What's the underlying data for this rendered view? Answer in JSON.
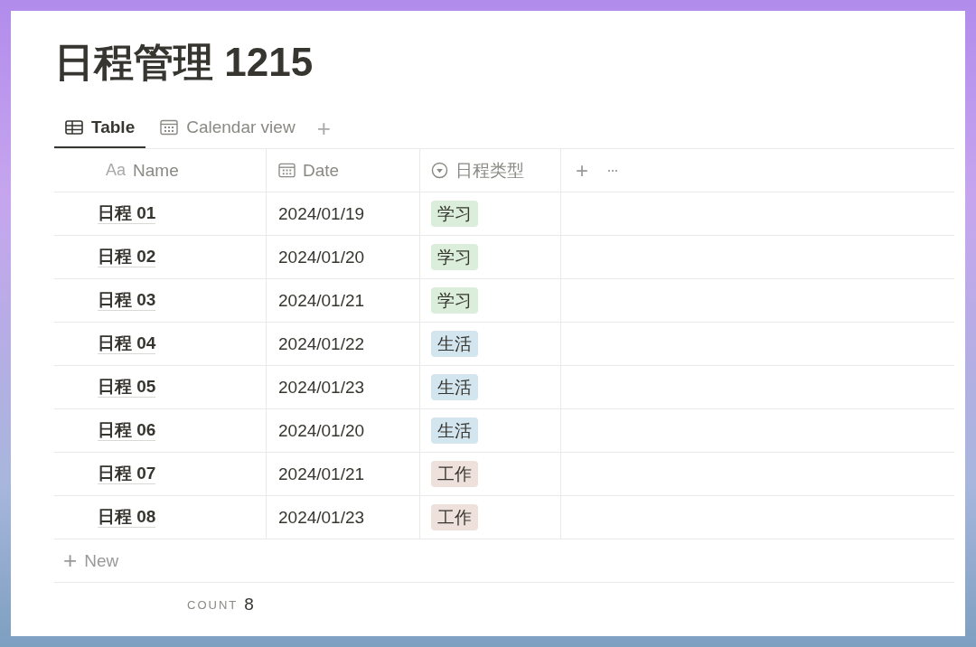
{
  "title": "日程管理 1215",
  "tabs": [
    {
      "label": "Table",
      "kind": "table",
      "selected": true
    },
    {
      "label": "Calendar view",
      "kind": "calendar",
      "selected": false
    }
  ],
  "add_view": "+",
  "columns": [
    {
      "label": "Name",
      "kind": "text",
      "glyph": "Aa"
    },
    {
      "label": "Date",
      "kind": "date"
    },
    {
      "label": "日程类型",
      "kind": "select"
    }
  ],
  "header_actions": {
    "add": "+",
    "more": "···"
  },
  "rows": [
    {
      "name": "日程 01",
      "date": "2024/01/19",
      "tag": "学习",
      "color": "#dbeddb"
    },
    {
      "name": "日程 02",
      "date": "2024/01/20",
      "tag": "学习",
      "color": "#dbeddb"
    },
    {
      "name": "日程 03",
      "date": "2024/01/21",
      "tag": "学习",
      "color": "#dbeddb"
    },
    {
      "name": "日程 04",
      "date": "2024/01/22",
      "tag": "生活",
      "color": "#d3e5ef"
    },
    {
      "name": "日程 05",
      "date": "2024/01/23",
      "tag": "生活",
      "color": "#d3e5ef"
    },
    {
      "name": "日程 06",
      "date": "2024/01/20",
      "tag": "生活",
      "color": "#d3e5ef"
    },
    {
      "name": "日程 07",
      "date": "2024/01/21",
      "tag": "工作",
      "color": "#eee0da"
    },
    {
      "name": "日程 08",
      "date": "2024/01/23",
      "tag": "工作",
      "color": "#eee0da"
    }
  ],
  "new_row": {
    "icon": "+",
    "label": "New"
  },
  "footer": {
    "label": "COUNT",
    "value": "8"
  }
}
